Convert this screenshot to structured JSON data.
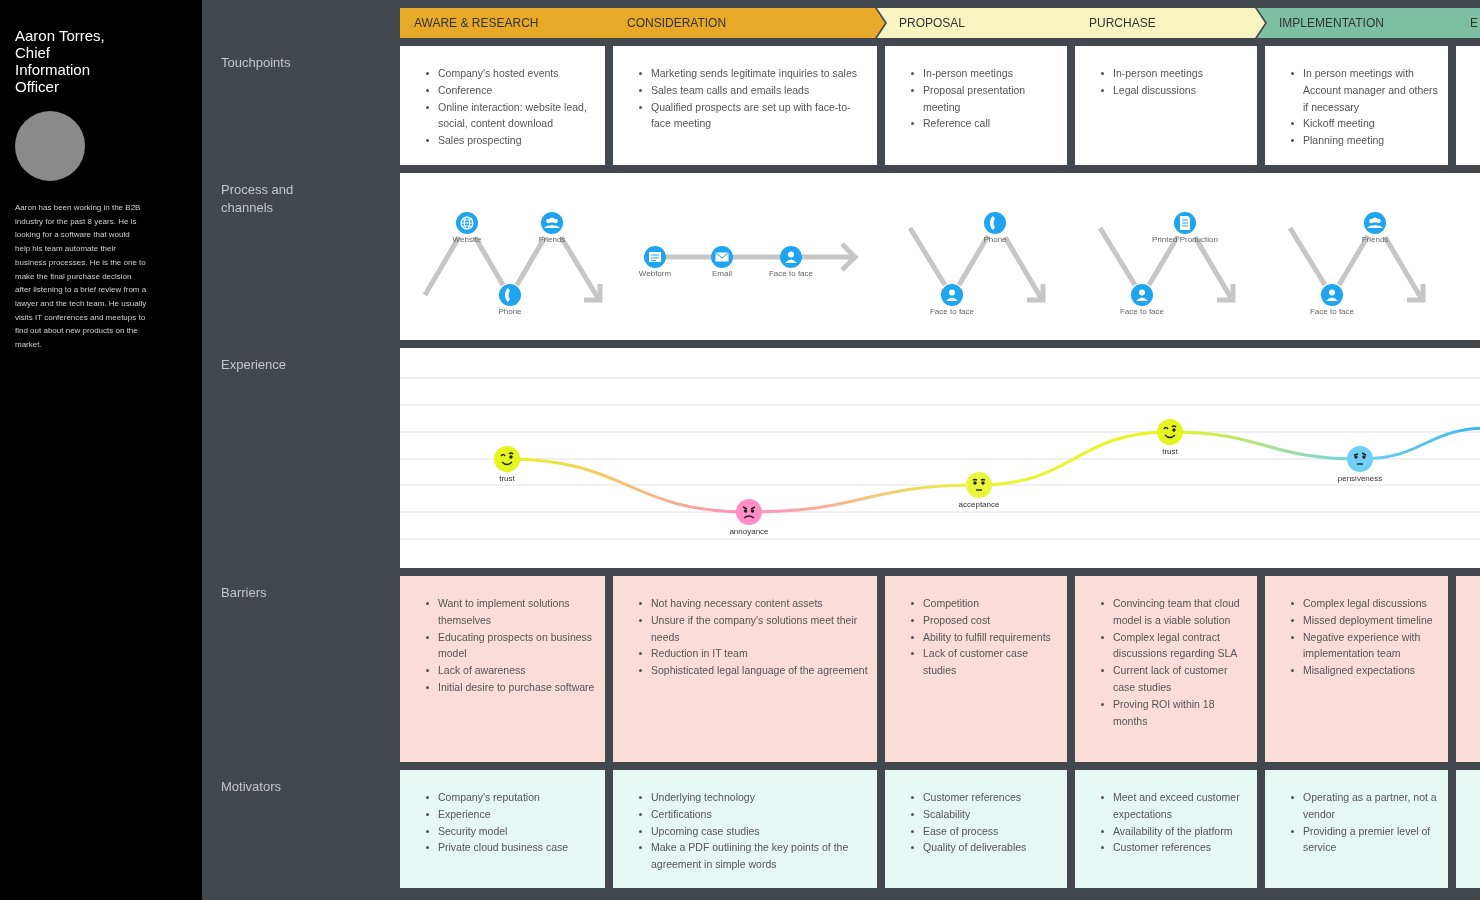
{
  "persona": {
    "name": "Aaron Torres, Chief Information Officer",
    "bio": "Aaron has been working in the B2B industry for the past 8 years. He is looking for a software that would help his team automate their business processes. He is the one to make the final purchase decision after listening to a brief review from a lawyer and the tech team. He usually visits IT conferences and meetups to find out about new products on the market."
  },
  "phases": [
    {
      "color": "#e6a928",
      "stages": [
        "AWARE & RESEARCH",
        "CONSIDERATION"
      ]
    },
    {
      "color": "#f6f5c2",
      "stages": [
        "PROPOSAL",
        "PURCHASE"
      ]
    },
    {
      "color": "#7dbfa3",
      "stages": [
        "IMPLEMENTATION",
        "E"
      ]
    }
  ],
  "rows": [
    {
      "label": "Touchpoints",
      "kind": "cards",
      "color": "#ffffff",
      "cards": [
        [
          "Company's hosted events",
          "Conference",
          "Online interaction: website lead, social, content download",
          "Sales prospecting"
        ],
        [
          "Marketing sends legitimate inquiries to sales",
          "Sales team calls and emails leads",
          "Qualified prospects are set up with face-to-face meeting"
        ],
        [
          "In-person meetings",
          "Proposal presentation meeting",
          "Reference call"
        ],
        [
          "In-person meetings",
          "Legal discussions"
        ],
        [
          "In person meetings with Account manager and others if necessary",
          "Kickoff meeting",
          "Planning meeting"
        ]
      ]
    },
    {
      "label": "Process and channels",
      "kind": "channels",
      "groups": [
        {
          "kind": "zigzag",
          "channels": [
            {
              "label": "Website",
              "kind": "globe"
            },
            {
              "label": "Phone",
              "kind": "phone"
            },
            {
              "label": "Friends",
              "kind": "people"
            }
          ]
        },
        {
          "kind": "line",
          "channels": [
            {
              "label": "Webform",
              "kind": "form"
            },
            {
              "label": "Email",
              "kind": "email"
            },
            {
              "label": "Face to face",
              "kind": "person"
            }
          ]
        },
        {
          "kind": "valley",
          "channels": [
            {
              "label": "Face to face",
              "kind": "person"
            },
            {
              "label": "Phone",
              "kind": "phone"
            }
          ]
        },
        {
          "kind": "valley",
          "channels": [
            {
              "label": "Face to face",
              "kind": "person"
            },
            {
              "label": "Printed Production",
              "kind": "document"
            }
          ]
        },
        {
          "kind": "valley",
          "channels": [
            {
              "label": "Face to face",
              "kind": "person"
            },
            {
              "label": "Friends",
              "kind": "people"
            }
          ]
        }
      ]
    },
    {
      "label": "Experience",
      "kind": "emotions",
      "points": [
        {
          "label": "trust",
          "kind": "wink",
          "color": "#e6f51e"
        },
        {
          "label": "annoyance",
          "kind": "sad",
          "color": "#ff8ec6"
        },
        {
          "label": "acceptance",
          "kind": "neutral",
          "color": "#eaf53c"
        },
        {
          "label": "trust",
          "kind": "wink",
          "color": "#e6f51e"
        },
        {
          "label": "pensiveness",
          "kind": "pensive",
          "color": "#6fcff5"
        }
      ]
    },
    {
      "label": "Barriers",
      "kind": "cards",
      "color": "#fadcd8",
      "cards": [
        [
          "Want to implement solutions themselves",
          "Educating prospects on business model",
          "Lack of awareness",
          "Initial desire to purchase software"
        ],
        [
          "Not having necessary content assets",
          "Unsure if the company's solutions meet their needs",
          "Reduction in IT team",
          "Sophisticated legal language of the agreement"
        ],
        [
          "Competition",
          "Proposed cost",
          "Ability to fulfill requirements",
          "Lack of customer case studies"
        ],
        [
          "Convincing team that cloud model is a viable solution",
          "Complex legal contract discussions regarding SLA",
          "Current lack of customer case studies",
          "Proving ROI within 18 months"
        ],
        [
          "Complex legal discussions",
          "Missed deployment timeline",
          "Negative experience with implementation team",
          "Misaligned expectations"
        ]
      ]
    },
    {
      "label": "Motivators",
      "kind": "cards",
      "color": "#e5f8f3",
      "cards": [
        [
          "Company's reputation",
          "Experience",
          "Security model",
          "Private cloud business case"
        ],
        [
          "Underlying technology",
          "Certifications",
          "Upcoming case studies",
          "Make a PDF outlining the key points of the agreement in simple words"
        ],
        [
          "Customer references",
          "Scalability",
          "Ease of process",
          "Quality of deliverables"
        ],
        [
          "Meet and exceed customer expectations",
          "Availability of the platform",
          "Customer references"
        ],
        [
          "Operating as a partner, not a vendor",
          "Providing a premier level of service"
        ]
      ]
    }
  ]
}
